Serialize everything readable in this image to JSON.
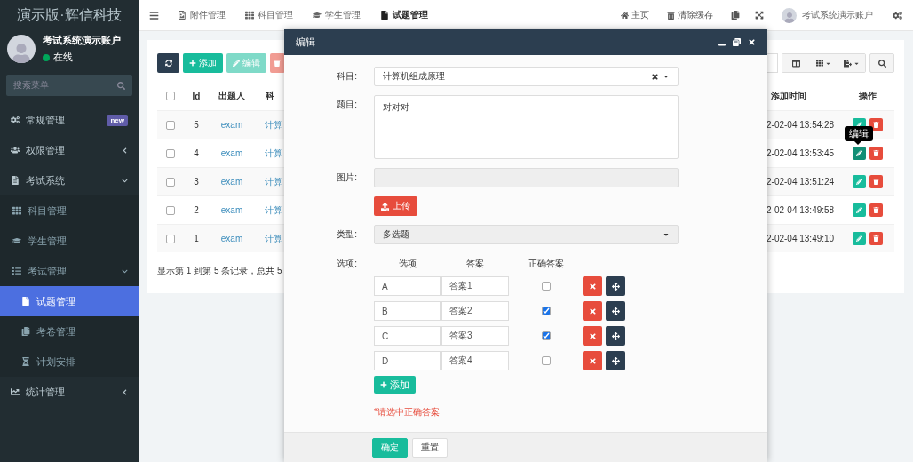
{
  "sidebar": {
    "brand": "演示版·辉信科技",
    "user": {
      "name": "考试系统演示账户",
      "status": "在线",
      "online": true
    },
    "search": {
      "placeholder": "搜索菜单"
    },
    "menu": [
      {
        "label": "常规管理",
        "badge": "new",
        "selected": false
      },
      {
        "label": "权限管理",
        "expanded": false,
        "selected": false
      },
      {
        "label": "考试系统",
        "expanded": true,
        "selected": false,
        "children": [
          {
            "label": "科目管理",
            "selected": false
          },
          {
            "label": "学生管理",
            "selected": false
          },
          {
            "label": "考试管理",
            "expanded": true,
            "selected": false,
            "children": [
              {
                "label": "试题管理",
                "selected": true
              },
              {
                "label": "考卷管理",
                "selected": false
              },
              {
                "label": "计划安排",
                "selected": false
              }
            ]
          }
        ]
      },
      {
        "label": "统计管理",
        "expanded": false,
        "selected": false
      }
    ]
  },
  "topbar": {
    "tabs": [
      {
        "label": "附件管理",
        "selected": false
      },
      {
        "label": "科目管理",
        "selected": false
      },
      {
        "label": "学生管理",
        "selected": false
      },
      {
        "label": "试题管理",
        "selected": true
      }
    ],
    "links": [
      {
        "label": "主页"
      },
      {
        "label": "清除缓存"
      }
    ],
    "account": "考试系统演示账户"
  },
  "table": {
    "toolbar": [
      {
        "kind": "refresh",
        "disabled": false
      },
      {
        "kind": "add",
        "label": "添加",
        "disabled": false
      },
      {
        "kind": "edit",
        "label": "编辑",
        "disabled": true
      },
      {
        "kind": "delete",
        "disabled": true
      }
    ],
    "header_checked": false,
    "columns": [
      "Id",
      "出题人",
      "科",
      "添加时间",
      "操作"
    ],
    "rows": [
      {
        "id": "5",
        "author": "exam",
        "subject": "计算",
        "time": "2-02-04 13:54:28",
        "checked": false,
        "hovered": false
      },
      {
        "id": "4",
        "author": "exam",
        "subject": "计算",
        "time": "2-02-04 13:53:45",
        "checked": false,
        "hovered": true,
        "tooltip": "编辑"
      },
      {
        "id": "3",
        "author": "exam",
        "subject": "计算",
        "time": "2-02-04 13:51:24",
        "checked": false,
        "hovered": false
      },
      {
        "id": "2",
        "author": "exam",
        "subject": "计算",
        "time": "2-02-04 13:49:58",
        "checked": false,
        "hovered": false
      },
      {
        "id": "1",
        "author": "exam",
        "subject": "计算",
        "time": "2-02-04 13:49:10",
        "checked": false,
        "hovered": false
      }
    ],
    "footer": "显示第 1 到第 5 条记录，总共 5"
  },
  "modal": {
    "title": "编辑",
    "subject": {
      "label": "科目:",
      "value": "计算机组成原理"
    },
    "question": {
      "label": "题目:",
      "value": "对对对"
    },
    "image": {
      "label": "图片:",
      "upload_button": "上传"
    },
    "type": {
      "label": "类型:",
      "value": "多选题"
    },
    "options": {
      "label": "选项:",
      "columns": [
        "选项",
        "答案",
        "正确答案"
      ],
      "rows": [
        {
          "key": "A",
          "answer": "答案1",
          "checked": false
        },
        {
          "key": "B",
          "answer": "答案2",
          "checked": true
        },
        {
          "key": "C",
          "answer": "答案3",
          "checked": true
        },
        {
          "key": "D",
          "answer": "答案4",
          "checked": false
        }
      ],
      "add_button": "添加",
      "hint": "*请选中正确答案"
    },
    "buttons": [
      {
        "label": "确定",
        "kind": "primary"
      },
      {
        "label": "重置",
        "kind": "default"
      }
    ]
  }
}
